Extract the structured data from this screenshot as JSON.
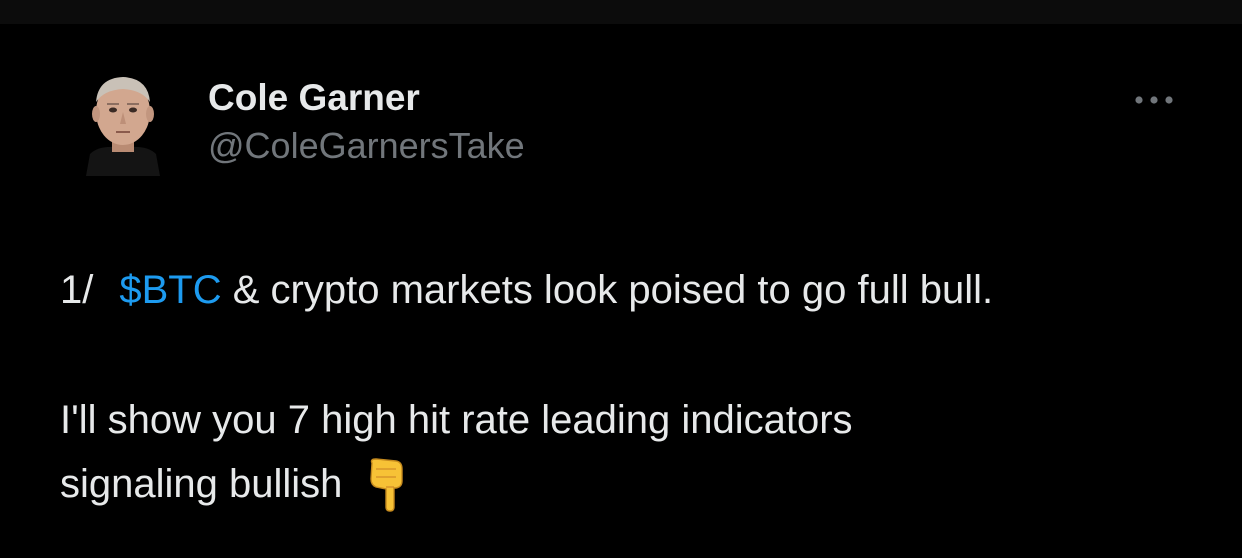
{
  "author": {
    "display_name": "Cole Garner",
    "handle": "@ColeGarnersTake",
    "avatar_icon": "profile-photo"
  },
  "menu": {
    "icon": "more-options-icon"
  },
  "tweet": {
    "thread_number": "1/",
    "cashtag": "$BTC",
    "line1_rest": "& crypto markets look poised to go full bull.",
    "line2": "I'll show you 7 high hit rate leading indicators",
    "line3": "signaling bullish",
    "emoji_icon": "backhand-index-pointing-down-icon"
  },
  "colors": {
    "background": "#000000",
    "text_primary": "#e7e9ea",
    "text_secondary": "#71767b",
    "link": "#1d9bf0",
    "emoji": "#f7c236"
  }
}
